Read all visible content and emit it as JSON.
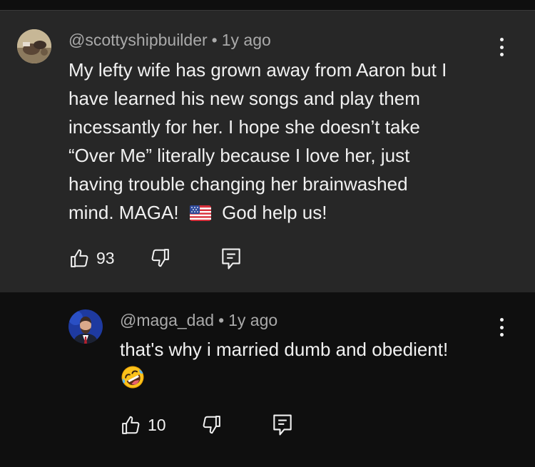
{
  "comment": {
    "handle": "@scottyshipbuilder",
    "age": "1y ago",
    "lines": [
      "My lefty wife has grown away from Aaron but I",
      "have learned his new songs and play them",
      "incessantly for her. I hope she doesn’t take",
      "“Over Me” literally because I love her, just",
      "having trouble changing her brainwashed"
    ],
    "last_line_before_flag": "mind. MAGA!",
    "last_line_after_flag": "God help us!",
    "likes": "93",
    "flag_icon": "us-flag-emoji",
    "colors": {
      "background": "#272727",
      "text": "#f1f1f1",
      "meta": "#aaaaaa"
    }
  },
  "reply": {
    "handle": "@maga_dad",
    "age": "1y ago",
    "text": "that's why i married dumb and obedient!",
    "emoji_icon": "rolling-on-the-floor-laughing-emoji",
    "likes": "10",
    "colors": {
      "background": "#0f0f0f"
    }
  },
  "separator_dot": "•"
}
